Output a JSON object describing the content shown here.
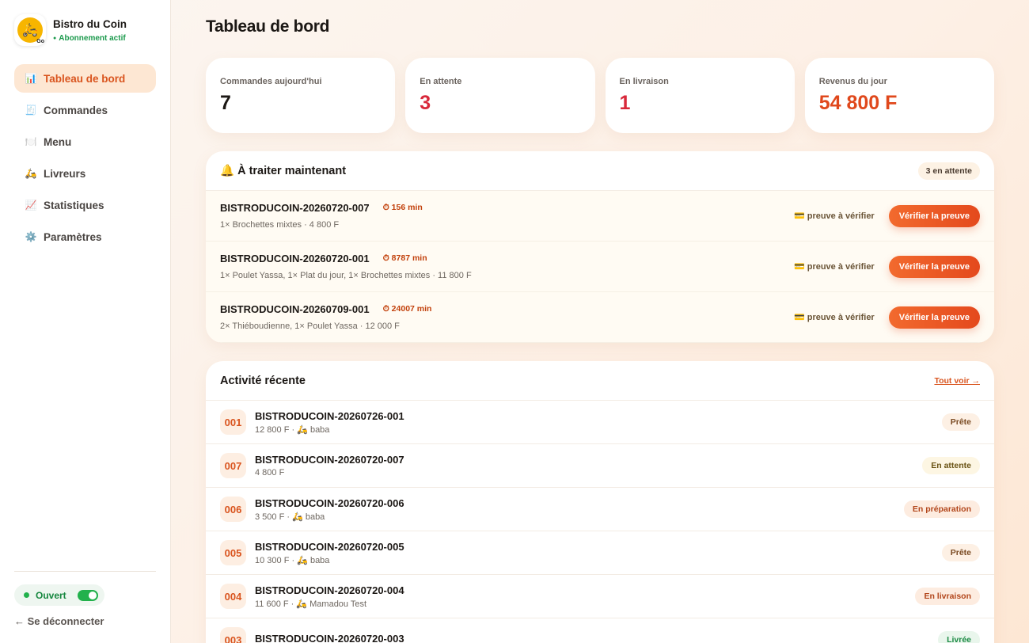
{
  "brand": {
    "name": "Bistro du Coin",
    "status": "Abonnement actif",
    "logo_text": "Go"
  },
  "nav": [
    {
      "icon": "📊",
      "label": "Tableau de bord",
      "active": true
    },
    {
      "icon": "🧾",
      "label": "Commandes"
    },
    {
      "icon": "🍽️",
      "label": "Menu"
    },
    {
      "icon": "🛵",
      "label": "Livreurs"
    },
    {
      "icon": "📈",
      "label": "Statistiques"
    },
    {
      "icon": "⚙️",
      "label": "Paramètres"
    }
  ],
  "open_toggle": {
    "label": "Ouvert",
    "on": true
  },
  "logout": "← Se déconnecter",
  "page_title": "Tableau de bord",
  "stats": [
    {
      "label": "Commandes aujourd'hui",
      "value": "7",
      "color": "#1b1714"
    },
    {
      "label": "En attente",
      "value": "3",
      "color": "#d8283a"
    },
    {
      "label": "En livraison",
      "value": "1",
      "color": "#d8283a"
    },
    {
      "label": "Revenus du jour",
      "value": "54 800 F",
      "color": "#e0481c"
    }
  ],
  "todo": {
    "title": "🔔 À traiter maintenant",
    "count_label": "3 en attente",
    "rows": [
      {
        "id": "BISTRODUCOIN-20260720-007",
        "timer": "⏱ 156 min",
        "items": "1× Brochettes mixtes · 4 800 F",
        "proof": "💳 preuve à vérifier",
        "action": "Vérifier la preuve"
      },
      {
        "id": "BISTRODUCOIN-20260720-001",
        "timer": "⏱ 8787 min",
        "items": "1× Poulet Yassa, 1× Plat du jour, 1× Brochettes mixtes · 11 800 F",
        "proof": "💳 preuve à vérifier",
        "action": "Vérifier la preuve"
      },
      {
        "id": "BISTRODUCOIN-20260709-001",
        "timer": "⏱ 24007 min",
        "items": "2× Thiéboudienne, 1× Poulet Yassa · 12 000 F",
        "proof": "💳 preuve à vérifier",
        "action": "Vérifier la preuve"
      }
    ]
  },
  "activity": {
    "title": "Activité récente",
    "see_all": "Tout voir →",
    "rows": [
      {
        "num": "001",
        "id": "BISTRODUCOIN-20260726-001",
        "sub": "12 800 F · 🛵 baba",
        "status": "Prête",
        "bg": "#fdf0e4",
        "fg": "#7a4a22"
      },
      {
        "num": "007",
        "id": "BISTRODUCOIN-20260720-007",
        "sub": "4 800 F",
        "status": "En attente",
        "bg": "#fdf6e3",
        "fg": "#6b5416"
      },
      {
        "num": "006",
        "id": "BISTRODUCOIN-20260720-006",
        "sub": "3 500 F · 🛵 baba",
        "status": "En préparation",
        "bg": "#fdece0",
        "fg": "#b2461b"
      },
      {
        "num": "005",
        "id": "BISTRODUCOIN-20260720-005",
        "sub": "10 300 F · 🛵 baba",
        "status": "Prête",
        "bg": "#fdf0e4",
        "fg": "#7a4a22"
      },
      {
        "num": "004",
        "id": "BISTRODUCOIN-20260720-004",
        "sub": "11 600 F · 🛵 Mamadou Test",
        "status": "En livraison",
        "bg": "#fdece0",
        "fg": "#b2461b"
      },
      {
        "num": "003",
        "id": "BISTRODUCOIN-20260720-003",
        "sub": "",
        "status": "Livrée",
        "bg": "#e9f6ec",
        "fg": "#1c8a44"
      }
    ]
  }
}
